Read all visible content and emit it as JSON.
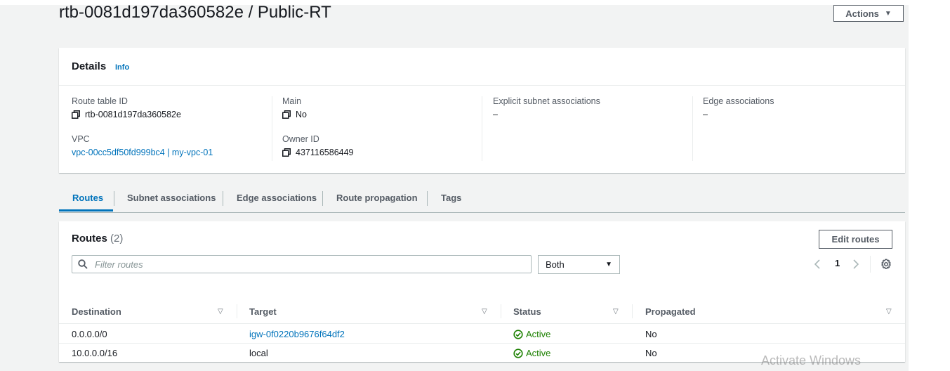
{
  "page": {
    "title": "rtb-0081d197da360582e / Public-RT",
    "actions_label": "Actions"
  },
  "details": {
    "title": "Details",
    "info_label": "Info",
    "route_table_id_label": "Route table ID",
    "route_table_id": "rtb-0081d197da360582e",
    "vpc_label": "VPC",
    "vpc_value": "vpc-00cc5df50fd999bc4 | my-vpc-01",
    "main_label": "Main",
    "main_value": "No",
    "owner_id_label": "Owner ID",
    "owner_id": "437116586449",
    "explicit_subnet_label": "Explicit subnet associations",
    "explicit_subnet_value": "–",
    "edge_assoc_label": "Edge associations",
    "edge_assoc_value": "–"
  },
  "tabs": [
    {
      "label": "Routes",
      "active": true
    },
    {
      "label": "Subnet associations",
      "active": false
    },
    {
      "label": "Edge associations",
      "active": false
    },
    {
      "label": "Route propagation",
      "active": false
    },
    {
      "label": "Tags",
      "active": false
    }
  ],
  "routes": {
    "title": "Routes",
    "count": "(2)",
    "edit_label": "Edit routes",
    "filter_placeholder": "Filter routes",
    "select_value": "Both",
    "page_number": "1",
    "columns": [
      "Destination",
      "Target",
      "Status",
      "Propagated"
    ],
    "rows": [
      {
        "destination": "0.0.0.0/0",
        "target": "igw-0f0220b9676f64df2",
        "target_is_link": true,
        "status": "Active",
        "propagated": "No"
      },
      {
        "destination": "10.0.0.0/16",
        "target": "local",
        "target_is_link": false,
        "status": "Active",
        "propagated": "No"
      }
    ]
  },
  "overlay": {
    "watermark": "Activate Windows"
  },
  "colors": {
    "link": "#0073bb",
    "success": "#1d8102",
    "page_bg": "#f2f3f3"
  }
}
